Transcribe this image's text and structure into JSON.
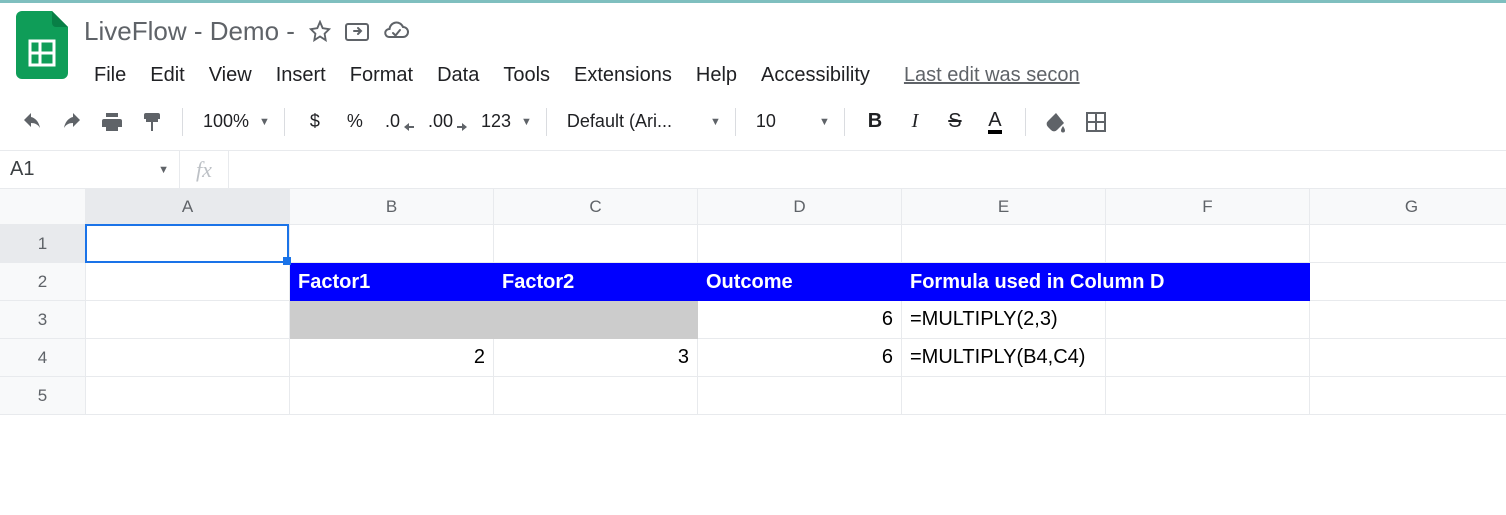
{
  "header": {
    "title": "LiveFlow - Demo -",
    "last_edit": "Last edit was secon"
  },
  "menu": {
    "file": "File",
    "edit": "Edit",
    "view": "View",
    "insert": "Insert",
    "format": "Format",
    "data": "Data",
    "tools": "Tools",
    "extensions": "Extensions",
    "help": "Help",
    "accessibility": "Accessibility"
  },
  "toolbar": {
    "zoom": "100%",
    "currency": "$",
    "percent": "%",
    "dec_dec": ".0",
    "inc_dec": ".00",
    "num_fmt": "123",
    "font": "Default (Ari...",
    "font_size": "10"
  },
  "namebox": {
    "ref": "A1"
  },
  "fx": {
    "label": "fx"
  },
  "columns": [
    "A",
    "B",
    "C",
    "D",
    "E",
    "F",
    "G"
  ],
  "rows": [
    "1",
    "2",
    "3",
    "4",
    "5"
  ],
  "cells": {
    "r2": {
      "B": "Factor1",
      "C": "Factor2",
      "D": "Outcome",
      "E": "Formula used in Column D"
    },
    "r3": {
      "D": "6",
      "E": "=MULTIPLY(2,3)"
    },
    "r4": {
      "B": "2",
      "C": "3",
      "D": "6",
      "E": "=MULTIPLY(B4,C4)"
    }
  },
  "active_cell": "A1"
}
